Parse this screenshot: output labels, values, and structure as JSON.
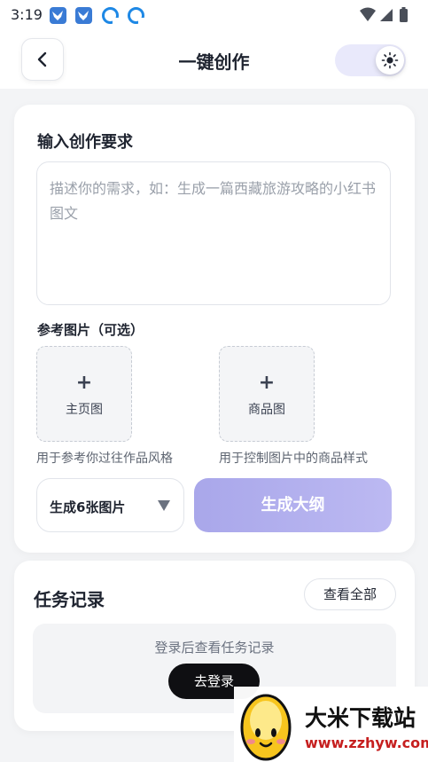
{
  "status_bar": {
    "time": "3:19",
    "icons": [
      "bird-notification-icon",
      "bird-notification-icon",
      "circle-notification-icon",
      "circle-notification-icon",
      "wifi-icon",
      "signal-icon",
      "battery-icon"
    ]
  },
  "header": {
    "title": "一键创作",
    "back_icon": "chevron-left-icon",
    "theme_icon": "sun-icon"
  },
  "create": {
    "section_title": "输入创作要求",
    "input": {
      "value": "",
      "placeholder": "描述你的需求，如：生成一篇西藏旅游攻略的小红书图文"
    },
    "reference_label": "参考图片（可选）",
    "uploads": [
      {
        "plus": "+",
        "label": "主页图",
        "hint": "用于参考你过往作品风格"
      },
      {
        "plus": "+",
        "label": "商品图",
        "hint": "用于控制图片中的商品样式"
      }
    ],
    "count_select": {
      "value": "生成6张图片",
      "icon": "triangle-down-icon"
    },
    "generate_label": "生成大纲",
    "accent": "#a9a7ea"
  },
  "tasks": {
    "title": "任务记录",
    "view_all_label": "查看全部",
    "empty_text": "登录后查看任务记录",
    "login_label": "去登录"
  },
  "watermark": {
    "title": "大米下载站",
    "url": "www.zzhyw.com"
  }
}
